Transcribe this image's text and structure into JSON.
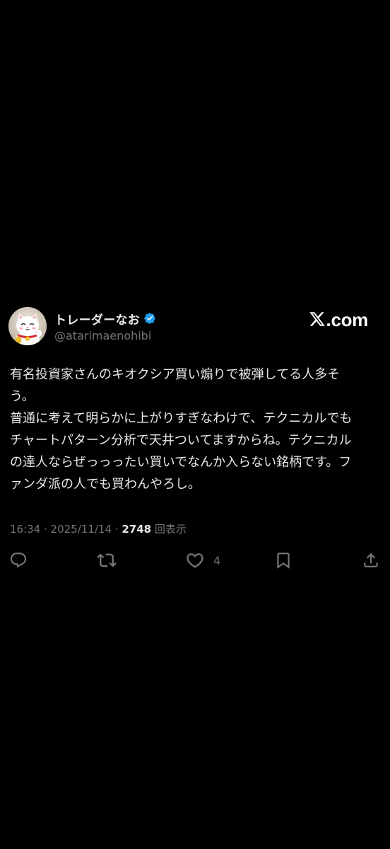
{
  "theme": {
    "background": "#000000",
    "text_primary": "#e7e9ea",
    "text_secondary": "#71767b",
    "verified_blue": "#1d9bf0"
  },
  "author": {
    "display_name": "トレーダーなお",
    "handle": "@atarimaenohibi",
    "verified": true,
    "avatar_icon": "maneki-neko-cat-avatar"
  },
  "site_logo": {
    "icon": "x-logo-icon",
    "suffix": ".com"
  },
  "post": {
    "lines": [
      "有名投資家さんのキオクシア買い煽りで被弾してる人多そ",
      "う。",
      "普通に考えて明らかに上がりすぎなわけで、テクニカルでも",
      "チャートパターン分析で天井ついてますからね。テクニカル",
      "の達人ならぜっっったい買いでなんか入らない銘柄です。フ",
      "ァンダ派の人でも買わんやろし。"
    ]
  },
  "meta": {
    "time": "16:34",
    "date": "2025/11/14",
    "separator": " · ",
    "views_count": "2748",
    "views_label": " 回表示"
  },
  "actions": {
    "reply_icon": "reply-icon",
    "repost_icon": "repost-icon",
    "like_icon": "heart-icon",
    "like_count": "4",
    "bookmark_icon": "bookmark-icon",
    "share_icon": "share-icon"
  }
}
